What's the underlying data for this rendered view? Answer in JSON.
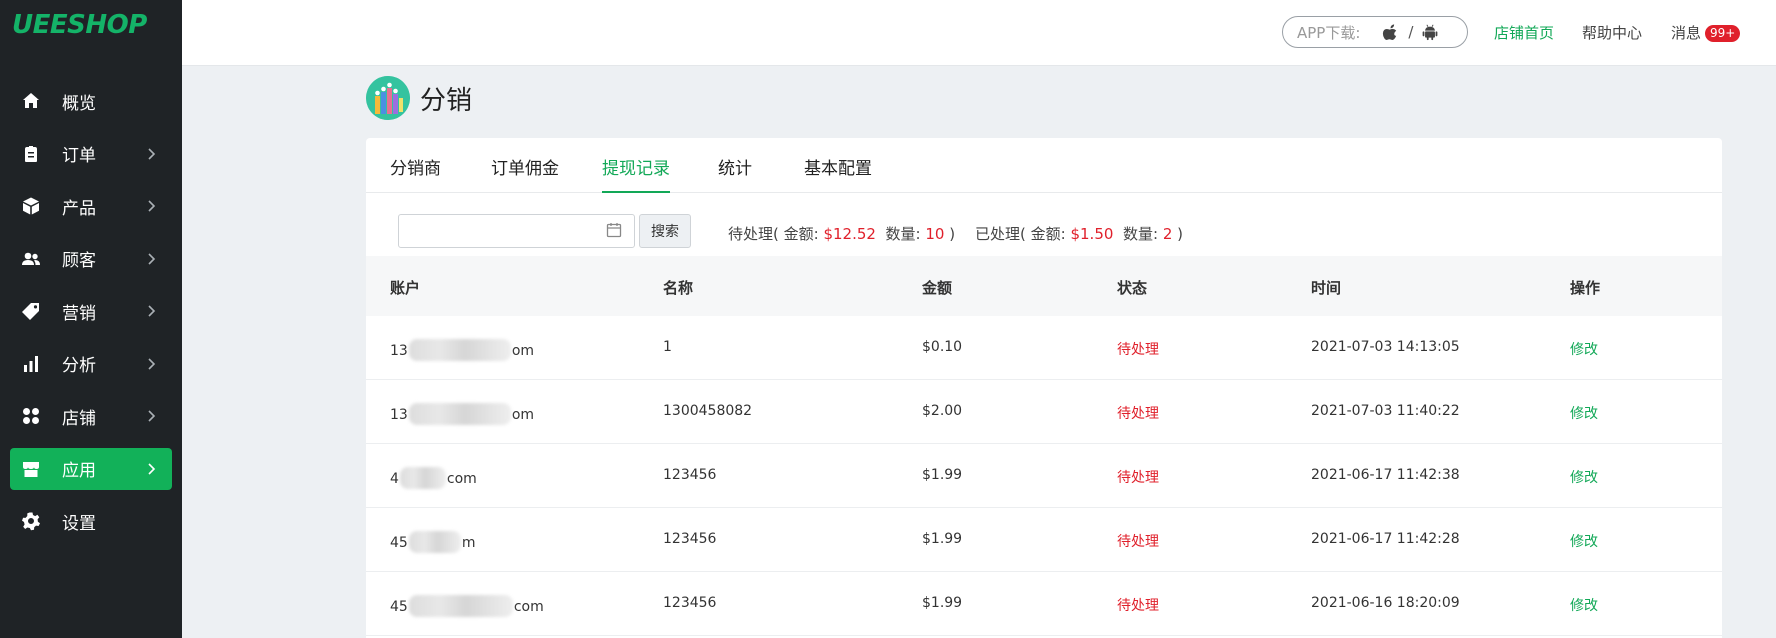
{
  "brand": {
    "logo_text": "UEESHOP",
    "accent": "#12b159"
  },
  "sidebar": {
    "items": [
      {
        "label": "概览",
        "icon": "home-icon",
        "has_arrow": false,
        "active": false
      },
      {
        "label": "订单",
        "icon": "clipboard-icon",
        "has_arrow": true,
        "active": false
      },
      {
        "label": "产品",
        "icon": "box-icon",
        "has_arrow": true,
        "active": false
      },
      {
        "label": "顾客",
        "icon": "users-icon",
        "has_arrow": true,
        "active": false
      },
      {
        "label": "营销",
        "icon": "tag-icon",
        "has_arrow": true,
        "active": false
      },
      {
        "label": "分析",
        "icon": "bar-chart-icon",
        "has_arrow": true,
        "active": false
      },
      {
        "label": "店铺",
        "icon": "grid-icon",
        "has_arrow": true,
        "active": false
      },
      {
        "label": "应用",
        "icon": "store-icon",
        "has_arrow": true,
        "active": true
      },
      {
        "label": "设置",
        "icon": "gear-icon",
        "has_arrow": false,
        "active": false
      }
    ]
  },
  "topbar": {
    "app_download_label": "APP下载:",
    "separator": "/",
    "shop_home": "店铺首页",
    "help_center": "帮助中心",
    "messages": "消息",
    "messages_badge": "99+"
  },
  "page": {
    "title": "分销"
  },
  "tabs": [
    {
      "label": "分销商",
      "active": false
    },
    {
      "label": "订单佣金",
      "active": false
    },
    {
      "label": "提现记录",
      "active": true
    },
    {
      "label": "统计",
      "active": false
    },
    {
      "label": "基本配置",
      "active": false
    }
  ],
  "filter": {
    "date_value": "",
    "search_label": "搜索",
    "pending": {
      "prefix": "待处理( 金额:",
      "amount": "$12.52",
      "count_label": "数量:",
      "count": "10",
      "suffix": ")"
    },
    "processed": {
      "prefix": "已处理( 金额:",
      "amount": "$1.50",
      "count_label": "数量:",
      "count": "2",
      "suffix": ")"
    }
  },
  "table": {
    "columns": [
      "账户",
      "名称",
      "金额",
      "状态",
      "时间",
      "操作"
    ],
    "rows": [
      {
        "account_start": "13",
        "account_end": "om",
        "name": "1",
        "amount": "$0.10",
        "status": "待处理",
        "time": "2021-07-03 14:13:05",
        "action": "修改"
      },
      {
        "account_start": "13",
        "account_end": "om",
        "name": "1300458082",
        "amount": "$2.00",
        "status": "待处理",
        "time": "2021-07-03 11:40:22",
        "action": "修改"
      },
      {
        "account_start": "4",
        "account_end": "com",
        "name": "123456",
        "amount": "$1.99",
        "status": "待处理",
        "time": "2021-06-17 11:42:38",
        "action": "修改"
      },
      {
        "account_start": "45",
        "account_end": "m",
        "name": "123456",
        "amount": "$1.99",
        "status": "待处理",
        "time": "2021-06-17 11:42:28",
        "action": "修改"
      },
      {
        "account_start": "45",
        "account_end": "com",
        "name": "123456",
        "amount": "$1.99",
        "status": "待处理",
        "time": "2021-06-16 18:20:09",
        "action": "修改"
      }
    ]
  }
}
